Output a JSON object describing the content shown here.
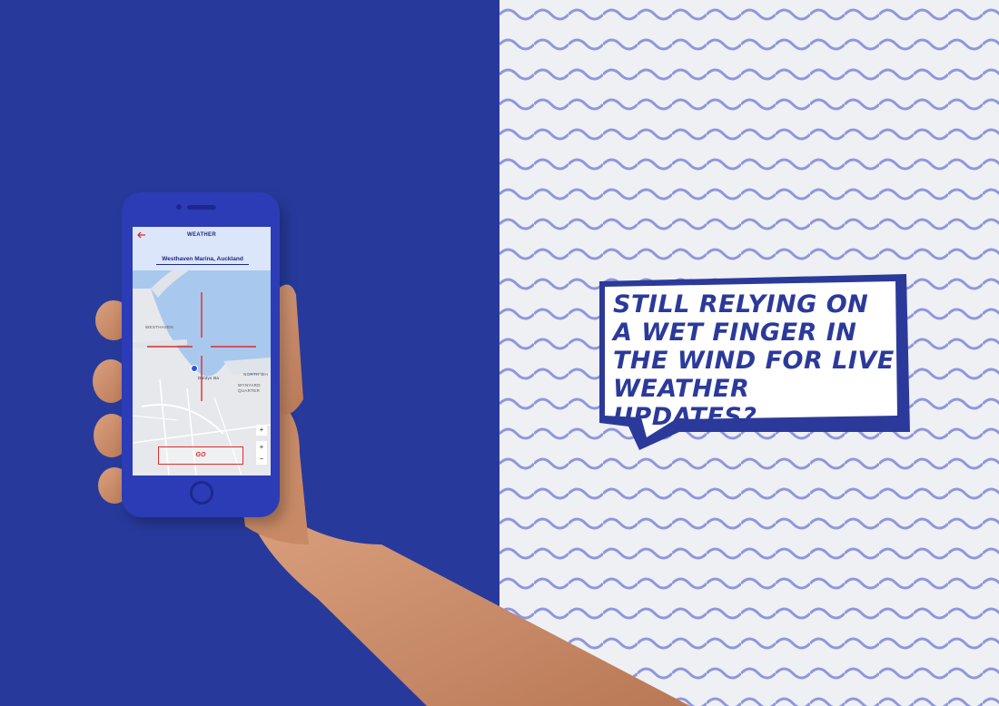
{
  "app": {
    "title": "WEATHER",
    "location": "Westhaven Marina, Auckland",
    "go_label": "GO",
    "zoom_in": "+",
    "zoom_in_2": "+",
    "zoom_out": "−"
  },
  "map_labels": {
    "westhaven": "WESTHAVEN",
    "north": "NORTH WH",
    "wynyard": "WYNYARD",
    "quarter": "QUARTER",
    "street": "Daldys Ba"
  },
  "ad": {
    "headline": "Still relying on a wet finger in the wind for live weather updates?"
  },
  "colors": {
    "left_background": "#273a9c",
    "right_background": "#eef0f4",
    "wave": "#8f97dc",
    "accent_red": "#e02b2b",
    "phone": "#2c3cb6",
    "text_navy": "#2b3a9a"
  },
  "icons": [
    "back-arrow-icon",
    "crosshair-icon",
    "location-dot-icon",
    "wave-pattern"
  ]
}
